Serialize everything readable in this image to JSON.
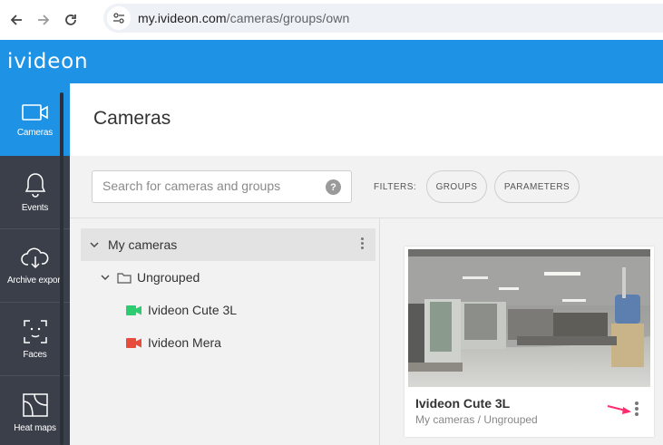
{
  "browser": {
    "url_host": "my.ivideon.com",
    "url_path": "/cameras/groups/own"
  },
  "header": {
    "logo": "ivideon"
  },
  "sidebar": {
    "items": [
      {
        "label": "Cameras",
        "icon": "camera-icon",
        "active": true
      },
      {
        "label": "Events",
        "icon": "bell-icon"
      },
      {
        "label": "Archive export",
        "icon": "cloud-download-icon"
      },
      {
        "label": "Faces",
        "icon": "face-scan-icon"
      },
      {
        "label": "Heat maps",
        "icon": "heat-map-icon"
      }
    ]
  },
  "page": {
    "title": "Cameras"
  },
  "search": {
    "placeholder": "Search for cameras and groups",
    "help": "?"
  },
  "filters": {
    "label": "FILTERS:",
    "groups": "GROUPS",
    "parameters": "PARAMETERS"
  },
  "tree": {
    "root": "My cameras",
    "group": "Ungrouped",
    "cameras": [
      {
        "name": "Ivideon Cute 3L",
        "status_color": "#2ecc71"
      },
      {
        "name": "Ivideon Mera",
        "status_color": "#e74c3c"
      }
    ]
  },
  "card": {
    "name": "Ivideon Cute 3L",
    "path": "My cameras / Ungrouped"
  },
  "colors": {
    "accent": "#1e93e6",
    "sidebar": "#3a3f4a",
    "arrow": "#ff2d6f"
  }
}
